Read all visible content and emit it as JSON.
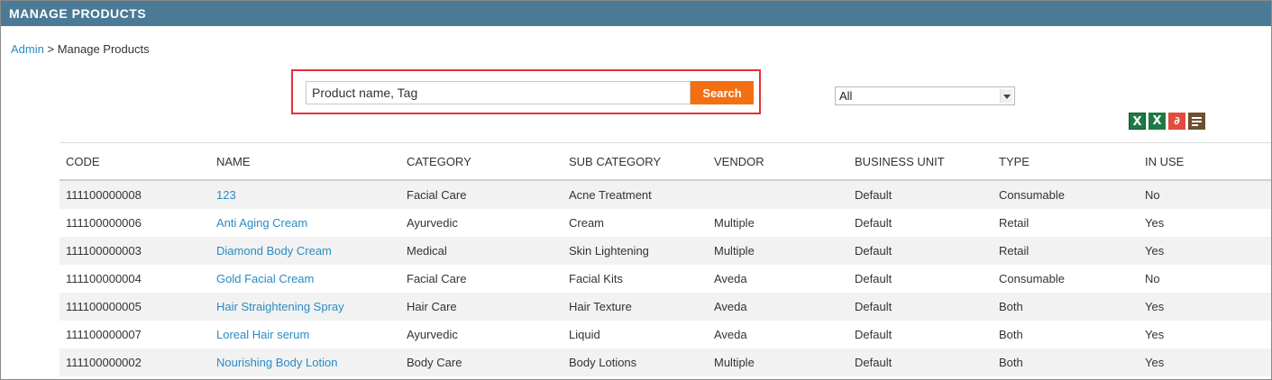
{
  "header": {
    "title": "MANAGE PRODUCTS"
  },
  "breadcrumb": {
    "root": "Admin",
    "separator": ">",
    "current": "Manage Products"
  },
  "search": {
    "value": "Product name, Tag",
    "button_label": "Search"
  },
  "filter": {
    "selected": "All"
  },
  "exports": [
    "excel-icon",
    "excel-icon",
    "pdf-icon",
    "text-file-icon"
  ],
  "table": {
    "columns": [
      "CODE",
      "NAME",
      "CATEGORY",
      "SUB CATEGORY",
      "VENDOR",
      "BUSINESS UNIT",
      "TYPE",
      "IN USE"
    ],
    "rows": [
      [
        "111100000008",
        "123",
        "Facial Care",
        "Acne Treatment",
        "",
        "Default",
        "Consumable",
        "No"
      ],
      [
        "111100000006",
        "Anti Aging Cream",
        "Ayurvedic",
        "Cream",
        "Multiple",
        "Default",
        "Retail",
        "Yes"
      ],
      [
        "111100000003",
        "Diamond Body Cream",
        "Medical",
        "Skin Lightening",
        "Multiple",
        "Default",
        "Retail",
        "Yes"
      ],
      [
        "111100000004",
        "Gold Facial Cream",
        "Facial Care",
        "Facial Kits",
        "Aveda",
        "Default",
        "Consumable",
        "No"
      ],
      [
        "111100000005",
        "Hair Straightening Spray",
        "Hair Care",
        "Hair Texture",
        "Aveda",
        "Default",
        "Both",
        "Yes"
      ],
      [
        "111100000007",
        "Loreal Hair serum",
        "Ayurvedic",
        "Liquid",
        "Aveda",
        "Default",
        "Both",
        "Yes"
      ],
      [
        "111100000002",
        "Nourishing Body Lotion",
        "Body Care",
        "Body Lotions",
        "Multiple",
        "Default",
        "Both",
        "Yes"
      ]
    ]
  },
  "colors": {
    "header_bg": "#4a7a96",
    "link": "#2a8bc2",
    "search_button": "#f36f12",
    "highlight_border": "#e2323c"
  }
}
